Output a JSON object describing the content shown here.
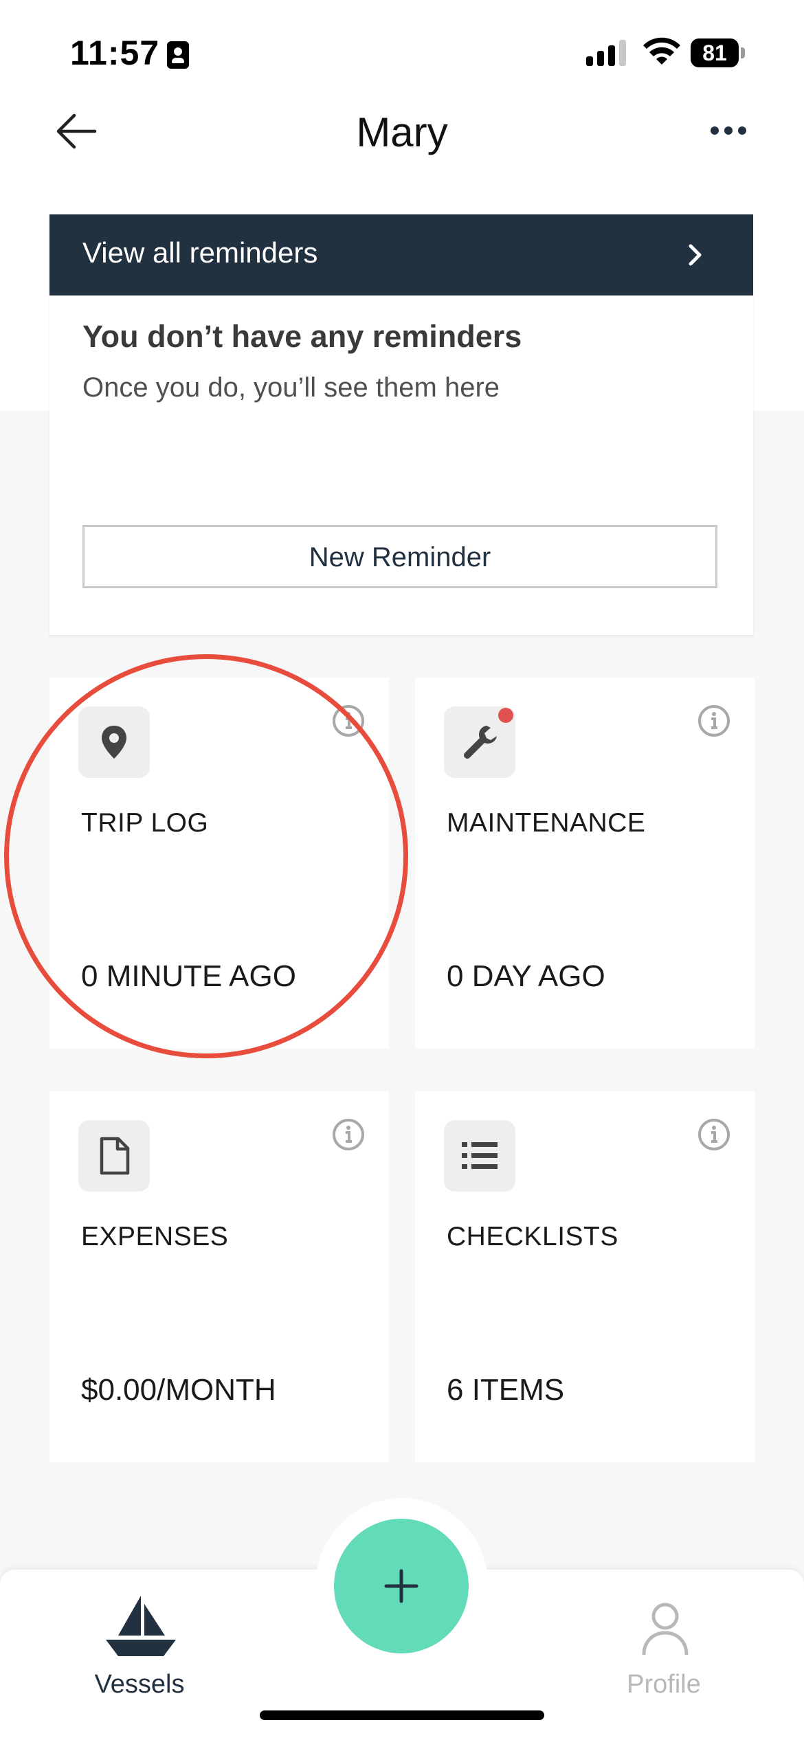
{
  "status_bar": {
    "time": "11:57",
    "battery": "81"
  },
  "header": {
    "title": "Mary"
  },
  "reminders": {
    "header_label": "View all reminders",
    "empty_title": "You don’t have any reminders",
    "empty_subtitle": "Once you do, you’ll see them here",
    "button_label": "New Reminder"
  },
  "tiles": [
    {
      "label": "TRIP LOG",
      "value": "0 MINUTE AGO",
      "icon": "map-pin-icon"
    },
    {
      "label": "MAINTENANCE",
      "value": "0 DAY AGO",
      "icon": "wrench-icon",
      "notification": true
    },
    {
      "label": "EXPENSES",
      "value": "$0.00/MONTH",
      "icon": "document-icon"
    },
    {
      "label": "CHECKLISTS",
      "value": "6 ITEMS",
      "icon": "list-icon"
    }
  ],
  "tabbar": {
    "vessels_label": "Vessels",
    "profile_label": "Profile"
  },
  "colors": {
    "header_dark": "#223140",
    "fab": "#63dbb9",
    "highlight": "#e74c3c",
    "notification_dot": "#e05252"
  }
}
